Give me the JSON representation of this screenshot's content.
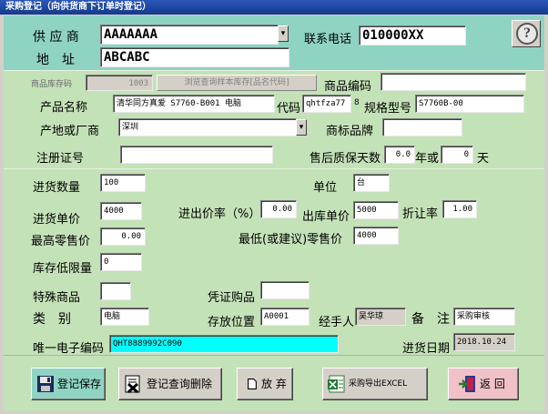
{
  "window": {
    "title": "采购登记（向供货商下订单时登记）"
  },
  "supplier": {
    "label": "供 应 商",
    "value": "AAAAAAA",
    "phone_label": "联系电话",
    "phone_value": "010000XX",
    "address_label": "地　址",
    "address_value": "ABCABC"
  },
  "inventory": {
    "code_label": "商品库存码",
    "code_value": "1003",
    "browse_button": "浏览查询样本库存[品名代码]",
    "product_code_label": "商品编码",
    "product_code_value": ""
  },
  "product": {
    "name_label": "产品名称",
    "name_value": "清华同方真爱 S7760-B001  电脑",
    "daima_label": "代码",
    "daima_value": "qhtfza77",
    "daima_suffix": "8",
    "spec_label": "规格型号",
    "spec_value": "S7760B-00",
    "origin_label": "产地或厂商",
    "origin_value": "深圳",
    "brand_label": "商标品牌",
    "brand_value": "",
    "reg_label": "注册证号",
    "reg_value": "",
    "warranty_label": "售后质保天数",
    "warranty_value": "0.0",
    "year_or_label": "年或",
    "days_value": "0",
    "days_label": "天"
  },
  "purchase": {
    "qty_label": "进货数量",
    "qty_value": "100",
    "unit_label": "单位",
    "unit_value": "台",
    "price_label": "进货单价",
    "price_value": "4000",
    "markup_label": "进出价率（%）",
    "markup_value": "0.00",
    "out_price_label": "出库单价",
    "out_price_value": "5000",
    "discount_label": "折让率",
    "discount_value": "1.00",
    "max_retail_label": "最高零售价",
    "max_retail_value": "0.00",
    "min_retail_label": "最低(或建议)零售价",
    "min_retail_value": "4000",
    "min_stock_label": "库存低限量",
    "min_stock_value": "0"
  },
  "misc": {
    "special_label": "特殊商品",
    "special_value": "",
    "voucher_label": "凭证购品",
    "voucher_value": "",
    "category_label": "类　别",
    "category_value": "电脑",
    "location_label": "存放位置",
    "location_value": "A0001",
    "handler_label": "经手人",
    "handler_value": "吴华琼",
    "note_label": "备　注",
    "note_value": "采购审核",
    "ecode_label": "唯一电子编码",
    "ecode_value": "QHT8889992C090",
    "date_label": "进货日期",
    "date_value": "2018.10.24"
  },
  "buttons": {
    "save": "登记保存",
    "query_delete": "登记查询删除",
    "discard": "放 弃",
    "export": "采购导出EXCEL",
    "back": "返 回"
  },
  "colors": {
    "title_bar": "#143c8c",
    "top_panel": "#8fd4c3",
    "main_panel": "#c4e2b8",
    "cyan_field": "#00ffff"
  }
}
